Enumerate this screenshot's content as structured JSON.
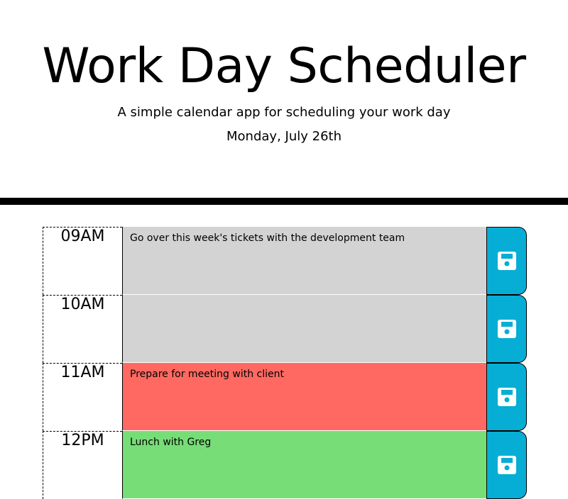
{
  "header": {
    "title": "Work Day Scheduler",
    "subtitle": "A simple calendar app for scheduling your work day",
    "current_day": "Monday, July 26th"
  },
  "schedule": {
    "rows": [
      {
        "hour": "09AM",
        "text": "Go over this week's tickets with the development team",
        "state": "past"
      },
      {
        "hour": "10AM",
        "text": "",
        "state": "past"
      },
      {
        "hour": "11AM",
        "text": "Prepare for meeting with client",
        "state": "present"
      },
      {
        "hour": "12PM",
        "text": "Lunch with Greg",
        "state": "future"
      }
    ],
    "save_icon": "floppy-disk-icon"
  },
  "colors": {
    "past": "#d3d3d3",
    "present": "#ff6961",
    "future": "#77dd77",
    "save_button": "#06aed5"
  }
}
